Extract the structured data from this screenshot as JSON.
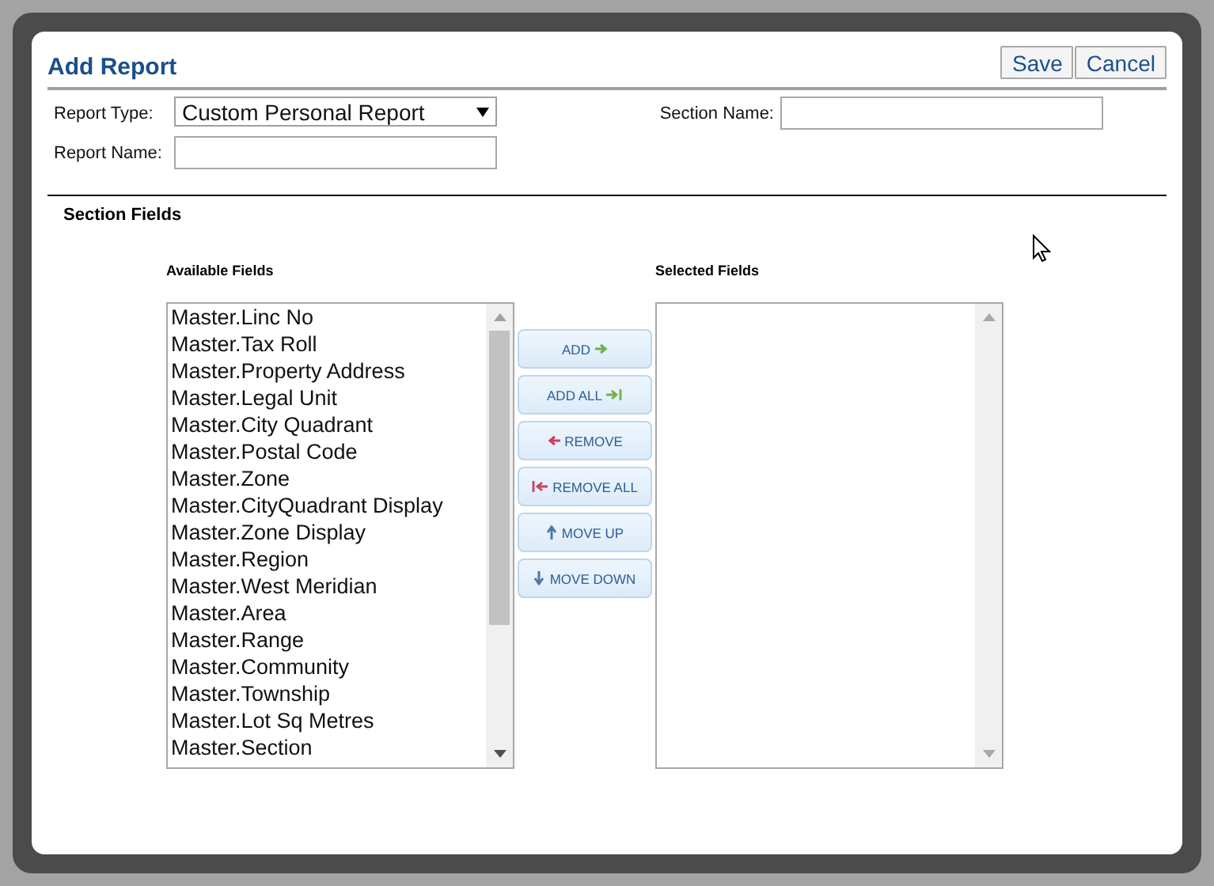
{
  "dialog": {
    "title": "Add Report",
    "buttons": [
      "Save",
      "Cancel"
    ]
  },
  "form": {
    "report_type": {
      "label": "Report Type:",
      "value": "Custom Personal Report"
    },
    "report_name": {
      "label": "Report Name:"
    },
    "section_name": {
      "label": "Section Name:"
    }
  },
  "section": {
    "title": "Section Fields",
    "available": {
      "label": "Available Fields",
      "items": [
        "Master.Linc No",
        "Master.Tax Roll",
        "Master.Property Address",
        "Master.Legal Unit",
        "Master.City Quadrant",
        "Master.Postal Code",
        "Master.Zone",
        "Master.CityQuadrant Display",
        "Master.Zone Display",
        "Master.Region",
        "Master.West Meridian",
        "Master.Area",
        "Master.Range",
        "Master.Community",
        "Master.Township",
        "Master.Lot Sq Metres",
        "Master.Section"
      ]
    },
    "actions": [
      {
        "label": "ADD",
        "kind": "add"
      },
      {
        "label": "ADD ALL",
        "kind": "add_all"
      },
      {
        "label": "REMOVE",
        "kind": "remove"
      },
      {
        "label": "REMOVE ALL",
        "kind": "remove_all"
      },
      {
        "label": "MOVE UP",
        "kind": "move_up"
      },
      {
        "label": "MOVE DOWN",
        "kind": "move_down"
      }
    ],
    "selected": {
      "label": "Selected Fields"
    }
  }
}
